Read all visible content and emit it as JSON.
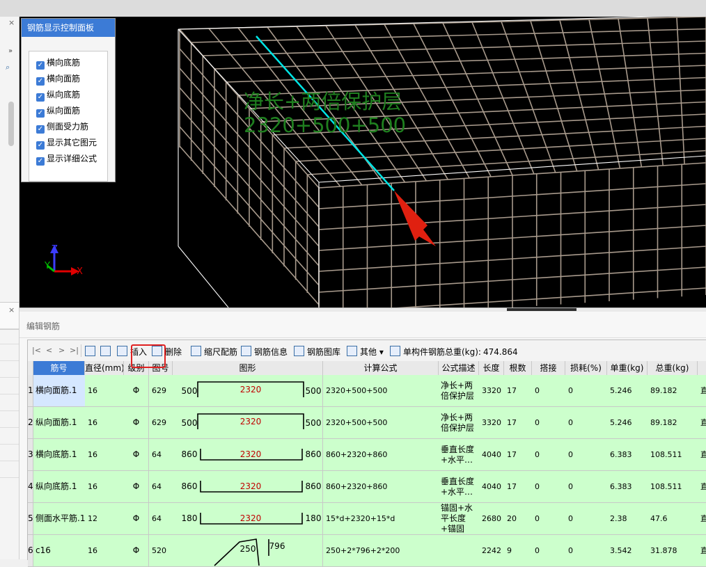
{
  "control_panel": {
    "title": "钢筋显示控制面板",
    "items": [
      {
        "label": "横向底筋",
        "checked": true
      },
      {
        "label": "横向面筋",
        "checked": true
      },
      {
        "label": "纵向底筋",
        "checked": true
      },
      {
        "label": "纵向面筋",
        "checked": true
      },
      {
        "label": "侧面受力筋",
        "checked": true
      },
      {
        "label": "显示其它图元",
        "checked": true
      },
      {
        "label": "显示详细公式",
        "checked": true
      }
    ]
  },
  "viewport": {
    "annotation_line1": "净长+两倍保护层",
    "annotation_line2": "2320+500+500",
    "axes": {
      "z": "Z",
      "y": "Y",
      "x": "X"
    }
  },
  "editor": {
    "title": "编辑钢筋",
    "toolbar": {
      "nav_first": "|<",
      "nav_prev": "<",
      "nav_next": ">",
      "nav_last": ">|",
      "insert": "插入",
      "delete": "删除",
      "scale_config": "缩尺配筋",
      "rebar_info": "钢筋信息",
      "rebar_library": "钢筋图库",
      "other": "其他",
      "total_weight_label": "单构件钢筋总重(kg):",
      "total_weight_value": "474.864"
    },
    "columns": [
      "筋号",
      "直径(mm)",
      "级别",
      "图号",
      "图形",
      "计算公式",
      "公式描述",
      "长度",
      "根数",
      "搭接",
      "损耗(%)",
      "单重(kg)",
      "总重(kg)"
    ],
    "grade_symbol": "Φ",
    "rows": [
      {
        "index": "1",
        "name": "横向面筋.1",
        "diameter": "16",
        "figure_no": "629",
        "shape": "hook_up",
        "left": "500",
        "center": "2320",
        "right": "500",
        "formula": "2320+500+500",
        "desc": "净长+两倍保护层",
        "length": "3320",
        "count": "17",
        "lap": "0",
        "loss": "0",
        "unit_weight": "5.246",
        "total_weight": "89.182",
        "trail": "直"
      },
      {
        "index": "2",
        "name": "纵向面筋.1",
        "diameter": "16",
        "figure_no": "629",
        "shape": "hook_up",
        "left": "500",
        "center": "2320",
        "right": "500",
        "formula": "2320+500+500",
        "desc": "净长+两倍保护层",
        "length": "3320",
        "count": "17",
        "lap": "0",
        "loss": "0",
        "unit_weight": "5.246",
        "total_weight": "89.182",
        "trail": "直"
      },
      {
        "index": "3",
        "name": "横向底筋.1",
        "diameter": "16",
        "figure_no": "64",
        "shape": "hook_down",
        "left": "860",
        "center": "2320",
        "right": "860",
        "formula": "860+2320+860",
        "desc": "垂直长度+水平…",
        "length": "4040",
        "count": "17",
        "lap": "0",
        "loss": "0",
        "unit_weight": "6.383",
        "total_weight": "108.511",
        "trail": "直"
      },
      {
        "index": "4",
        "name": "纵向底筋.1",
        "diameter": "16",
        "figure_no": "64",
        "shape": "hook_down",
        "left": "860",
        "center": "2320",
        "right": "860",
        "formula": "860+2320+860",
        "desc": "垂直长度+水平…",
        "length": "4040",
        "count": "17",
        "lap": "0",
        "loss": "0",
        "unit_weight": "6.383",
        "total_weight": "108.511",
        "trail": "直"
      },
      {
        "index": "5",
        "name": "侧面水平筋.1",
        "diameter": "12",
        "figure_no": "64",
        "shape": "hook_down",
        "left": "180",
        "center": "2320",
        "right": "180",
        "formula": "15*d+2320+15*d",
        "desc": "锚固+水平长度+锚固",
        "length": "2680",
        "count": "20",
        "lap": "0",
        "loss": "0",
        "unit_weight": "2.38",
        "total_weight": "47.6",
        "trail": "直"
      },
      {
        "index": "6",
        "name": "c16",
        "diameter": "16",
        "figure_no": "520",
        "shape": "bent",
        "left": "",
        "center": "250",
        "right": "796",
        "formula": "250+2*796+2*200",
        "desc": "",
        "length": "2242",
        "count": "9",
        "lap": "0",
        "loss": "0",
        "unit_weight": "3.542",
        "total_weight": "31.878",
        "trail": "直"
      }
    ]
  }
}
